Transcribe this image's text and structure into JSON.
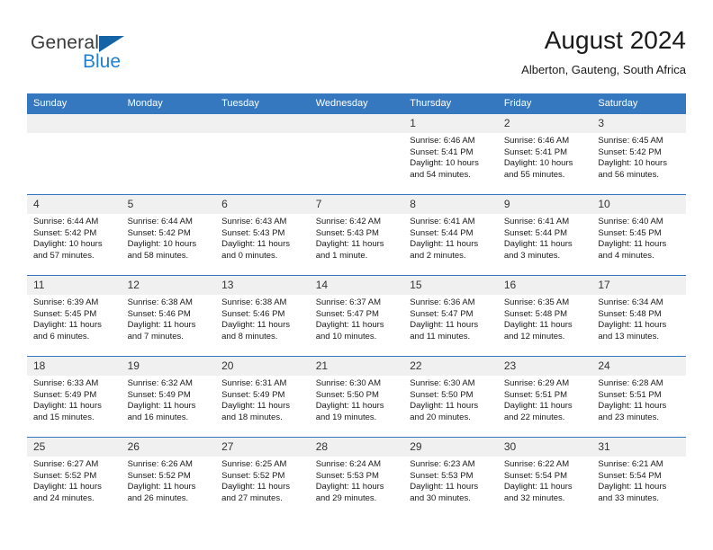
{
  "brand": {
    "name_top": "General",
    "name_bottom": "Blue",
    "triangle_color": "#1464a5",
    "blue_color": "#1f7fd0"
  },
  "header": {
    "title": "August 2024",
    "subtitle": "Alberton, Gauteng, South Africa"
  },
  "theme": {
    "header_blue": "#3578bf",
    "daynum_bg": "#f0f0f0"
  },
  "weekday_headers": [
    "Sunday",
    "Monday",
    "Tuesday",
    "Wednesday",
    "Thursday",
    "Friday",
    "Saturday"
  ],
  "weeks": [
    [
      {
        "day": "",
        "sunrise": "",
        "sunset": "",
        "daylight1": "",
        "daylight2": ""
      },
      {
        "day": "",
        "sunrise": "",
        "sunset": "",
        "daylight1": "",
        "daylight2": ""
      },
      {
        "day": "",
        "sunrise": "",
        "sunset": "",
        "daylight1": "",
        "daylight2": ""
      },
      {
        "day": "",
        "sunrise": "",
        "sunset": "",
        "daylight1": "",
        "daylight2": ""
      },
      {
        "day": "1",
        "sunrise": "Sunrise: 6:46 AM",
        "sunset": "Sunset: 5:41 PM",
        "daylight1": "Daylight: 10 hours",
        "daylight2": "and 54 minutes."
      },
      {
        "day": "2",
        "sunrise": "Sunrise: 6:46 AM",
        "sunset": "Sunset: 5:41 PM",
        "daylight1": "Daylight: 10 hours",
        "daylight2": "and 55 minutes."
      },
      {
        "day": "3",
        "sunrise": "Sunrise: 6:45 AM",
        "sunset": "Sunset: 5:42 PM",
        "daylight1": "Daylight: 10 hours",
        "daylight2": "and 56 minutes."
      }
    ],
    [
      {
        "day": "4",
        "sunrise": "Sunrise: 6:44 AM",
        "sunset": "Sunset: 5:42 PM",
        "daylight1": "Daylight: 10 hours",
        "daylight2": "and 57 minutes."
      },
      {
        "day": "5",
        "sunrise": "Sunrise: 6:44 AM",
        "sunset": "Sunset: 5:42 PM",
        "daylight1": "Daylight: 10 hours",
        "daylight2": "and 58 minutes."
      },
      {
        "day": "6",
        "sunrise": "Sunrise: 6:43 AM",
        "sunset": "Sunset: 5:43 PM",
        "daylight1": "Daylight: 11 hours",
        "daylight2": "and 0 minutes."
      },
      {
        "day": "7",
        "sunrise": "Sunrise: 6:42 AM",
        "sunset": "Sunset: 5:43 PM",
        "daylight1": "Daylight: 11 hours",
        "daylight2": "and 1 minute."
      },
      {
        "day": "8",
        "sunrise": "Sunrise: 6:41 AM",
        "sunset": "Sunset: 5:44 PM",
        "daylight1": "Daylight: 11 hours",
        "daylight2": "and 2 minutes."
      },
      {
        "day": "9",
        "sunrise": "Sunrise: 6:41 AM",
        "sunset": "Sunset: 5:44 PM",
        "daylight1": "Daylight: 11 hours",
        "daylight2": "and 3 minutes."
      },
      {
        "day": "10",
        "sunrise": "Sunrise: 6:40 AM",
        "sunset": "Sunset: 5:45 PM",
        "daylight1": "Daylight: 11 hours",
        "daylight2": "and 4 minutes."
      }
    ],
    [
      {
        "day": "11",
        "sunrise": "Sunrise: 6:39 AM",
        "sunset": "Sunset: 5:45 PM",
        "daylight1": "Daylight: 11 hours",
        "daylight2": "and 6 minutes."
      },
      {
        "day": "12",
        "sunrise": "Sunrise: 6:38 AM",
        "sunset": "Sunset: 5:46 PM",
        "daylight1": "Daylight: 11 hours",
        "daylight2": "and 7 minutes."
      },
      {
        "day": "13",
        "sunrise": "Sunrise: 6:38 AM",
        "sunset": "Sunset: 5:46 PM",
        "daylight1": "Daylight: 11 hours",
        "daylight2": "and 8 minutes."
      },
      {
        "day": "14",
        "sunrise": "Sunrise: 6:37 AM",
        "sunset": "Sunset: 5:47 PM",
        "daylight1": "Daylight: 11 hours",
        "daylight2": "and 10 minutes."
      },
      {
        "day": "15",
        "sunrise": "Sunrise: 6:36 AM",
        "sunset": "Sunset: 5:47 PM",
        "daylight1": "Daylight: 11 hours",
        "daylight2": "and 11 minutes."
      },
      {
        "day": "16",
        "sunrise": "Sunrise: 6:35 AM",
        "sunset": "Sunset: 5:48 PM",
        "daylight1": "Daylight: 11 hours",
        "daylight2": "and 12 minutes."
      },
      {
        "day": "17",
        "sunrise": "Sunrise: 6:34 AM",
        "sunset": "Sunset: 5:48 PM",
        "daylight1": "Daylight: 11 hours",
        "daylight2": "and 13 minutes."
      }
    ],
    [
      {
        "day": "18",
        "sunrise": "Sunrise: 6:33 AM",
        "sunset": "Sunset: 5:49 PM",
        "daylight1": "Daylight: 11 hours",
        "daylight2": "and 15 minutes."
      },
      {
        "day": "19",
        "sunrise": "Sunrise: 6:32 AM",
        "sunset": "Sunset: 5:49 PM",
        "daylight1": "Daylight: 11 hours",
        "daylight2": "and 16 minutes."
      },
      {
        "day": "20",
        "sunrise": "Sunrise: 6:31 AM",
        "sunset": "Sunset: 5:49 PM",
        "daylight1": "Daylight: 11 hours",
        "daylight2": "and 18 minutes."
      },
      {
        "day": "21",
        "sunrise": "Sunrise: 6:30 AM",
        "sunset": "Sunset: 5:50 PM",
        "daylight1": "Daylight: 11 hours",
        "daylight2": "and 19 minutes."
      },
      {
        "day": "22",
        "sunrise": "Sunrise: 6:30 AM",
        "sunset": "Sunset: 5:50 PM",
        "daylight1": "Daylight: 11 hours",
        "daylight2": "and 20 minutes."
      },
      {
        "day": "23",
        "sunrise": "Sunrise: 6:29 AM",
        "sunset": "Sunset: 5:51 PM",
        "daylight1": "Daylight: 11 hours",
        "daylight2": "and 22 minutes."
      },
      {
        "day": "24",
        "sunrise": "Sunrise: 6:28 AM",
        "sunset": "Sunset: 5:51 PM",
        "daylight1": "Daylight: 11 hours",
        "daylight2": "and 23 minutes."
      }
    ],
    [
      {
        "day": "25",
        "sunrise": "Sunrise: 6:27 AM",
        "sunset": "Sunset: 5:52 PM",
        "daylight1": "Daylight: 11 hours",
        "daylight2": "and 24 minutes."
      },
      {
        "day": "26",
        "sunrise": "Sunrise: 6:26 AM",
        "sunset": "Sunset: 5:52 PM",
        "daylight1": "Daylight: 11 hours",
        "daylight2": "and 26 minutes."
      },
      {
        "day": "27",
        "sunrise": "Sunrise: 6:25 AM",
        "sunset": "Sunset: 5:52 PM",
        "daylight1": "Daylight: 11 hours",
        "daylight2": "and 27 minutes."
      },
      {
        "day": "28",
        "sunrise": "Sunrise: 6:24 AM",
        "sunset": "Sunset: 5:53 PM",
        "daylight1": "Daylight: 11 hours",
        "daylight2": "and 29 minutes."
      },
      {
        "day": "29",
        "sunrise": "Sunrise: 6:23 AM",
        "sunset": "Sunset: 5:53 PM",
        "daylight1": "Daylight: 11 hours",
        "daylight2": "and 30 minutes."
      },
      {
        "day": "30",
        "sunrise": "Sunrise: 6:22 AM",
        "sunset": "Sunset: 5:54 PM",
        "daylight1": "Daylight: 11 hours",
        "daylight2": "and 32 minutes."
      },
      {
        "day": "31",
        "sunrise": "Sunrise: 6:21 AM",
        "sunset": "Sunset: 5:54 PM",
        "daylight1": "Daylight: 11 hours",
        "daylight2": "and 33 minutes."
      }
    ]
  ]
}
